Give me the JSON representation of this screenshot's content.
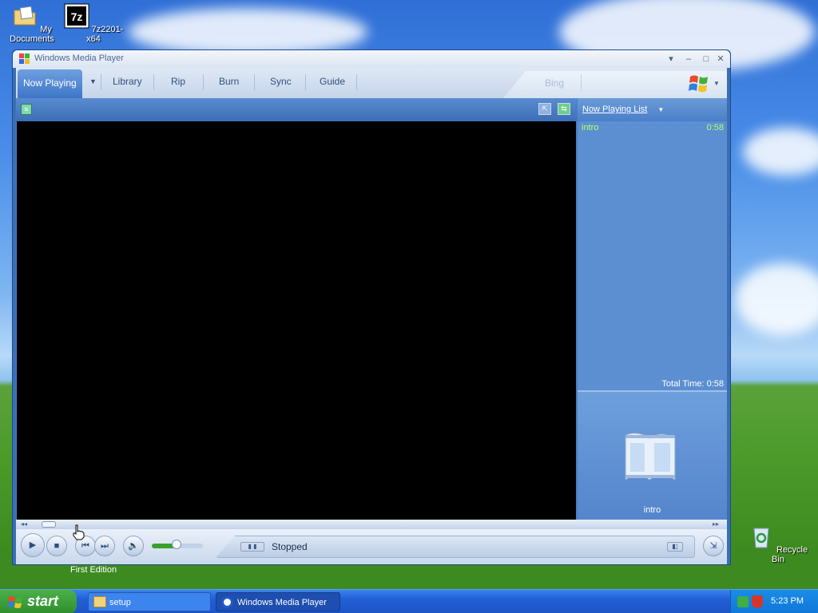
{
  "desktop": {
    "icons": [
      {
        "label": "My Documents"
      },
      {
        "label": "7z2201-x64"
      },
      {
        "label": "Recycle Bin"
      }
    ],
    "obscured_text": "First Edition"
  },
  "window": {
    "title": "Windows Media Player",
    "tabs": [
      {
        "label": "Now Playing",
        "active": true
      },
      {
        "label": "Library"
      },
      {
        "label": "Rip"
      },
      {
        "label": "Burn"
      },
      {
        "label": "Sync"
      },
      {
        "label": "Guide"
      },
      {
        "label": "Bing"
      }
    ],
    "playlist": {
      "header": "Now Playing List",
      "items": [
        {
          "title": "intro",
          "duration": "0:58"
        }
      ],
      "total": "Total Time: 0:58",
      "album_caption": "intro"
    },
    "status": "Stopped"
  },
  "taskbar": {
    "start_label": "start",
    "tasks": [
      {
        "label": "setup"
      },
      {
        "label": "Windows Media Player"
      }
    ],
    "clock": "5:23 PM"
  },
  "colors": {
    "playlist_item": "#b8ff6a",
    "wmp_blue": "#3b6fb5"
  }
}
